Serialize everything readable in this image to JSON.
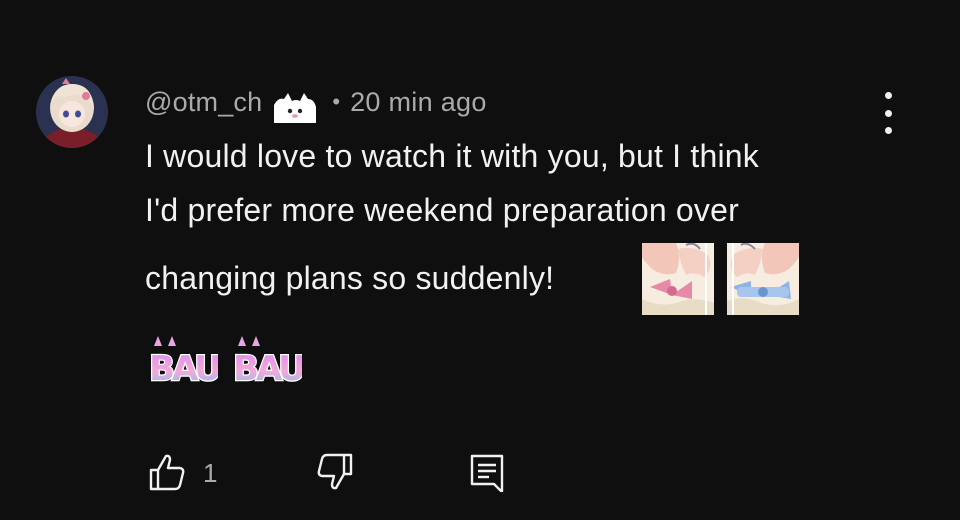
{
  "comment": {
    "author": "@otm_ch",
    "separator": "•",
    "time": "20 min ago",
    "text": {
      "line1": "I would love to watch it with you, but I think",
      "line2": "I'd prefer more weekend preparation over",
      "line3": "changing plans so suddenly!"
    },
    "emotes": [
      "bau-text-emote",
      "bau-text-emote"
    ],
    "like_count": "1"
  },
  "icons": {
    "menu": "three-dots-vertical-icon",
    "like": "thumbs-up-icon",
    "dislike": "thumbs-down-icon",
    "reply": "reply-comment-icon"
  },
  "colors": {
    "background": "#0f0f0f",
    "primary_text": "#f1f1f1",
    "secondary_text": "#aaaaaa"
  }
}
